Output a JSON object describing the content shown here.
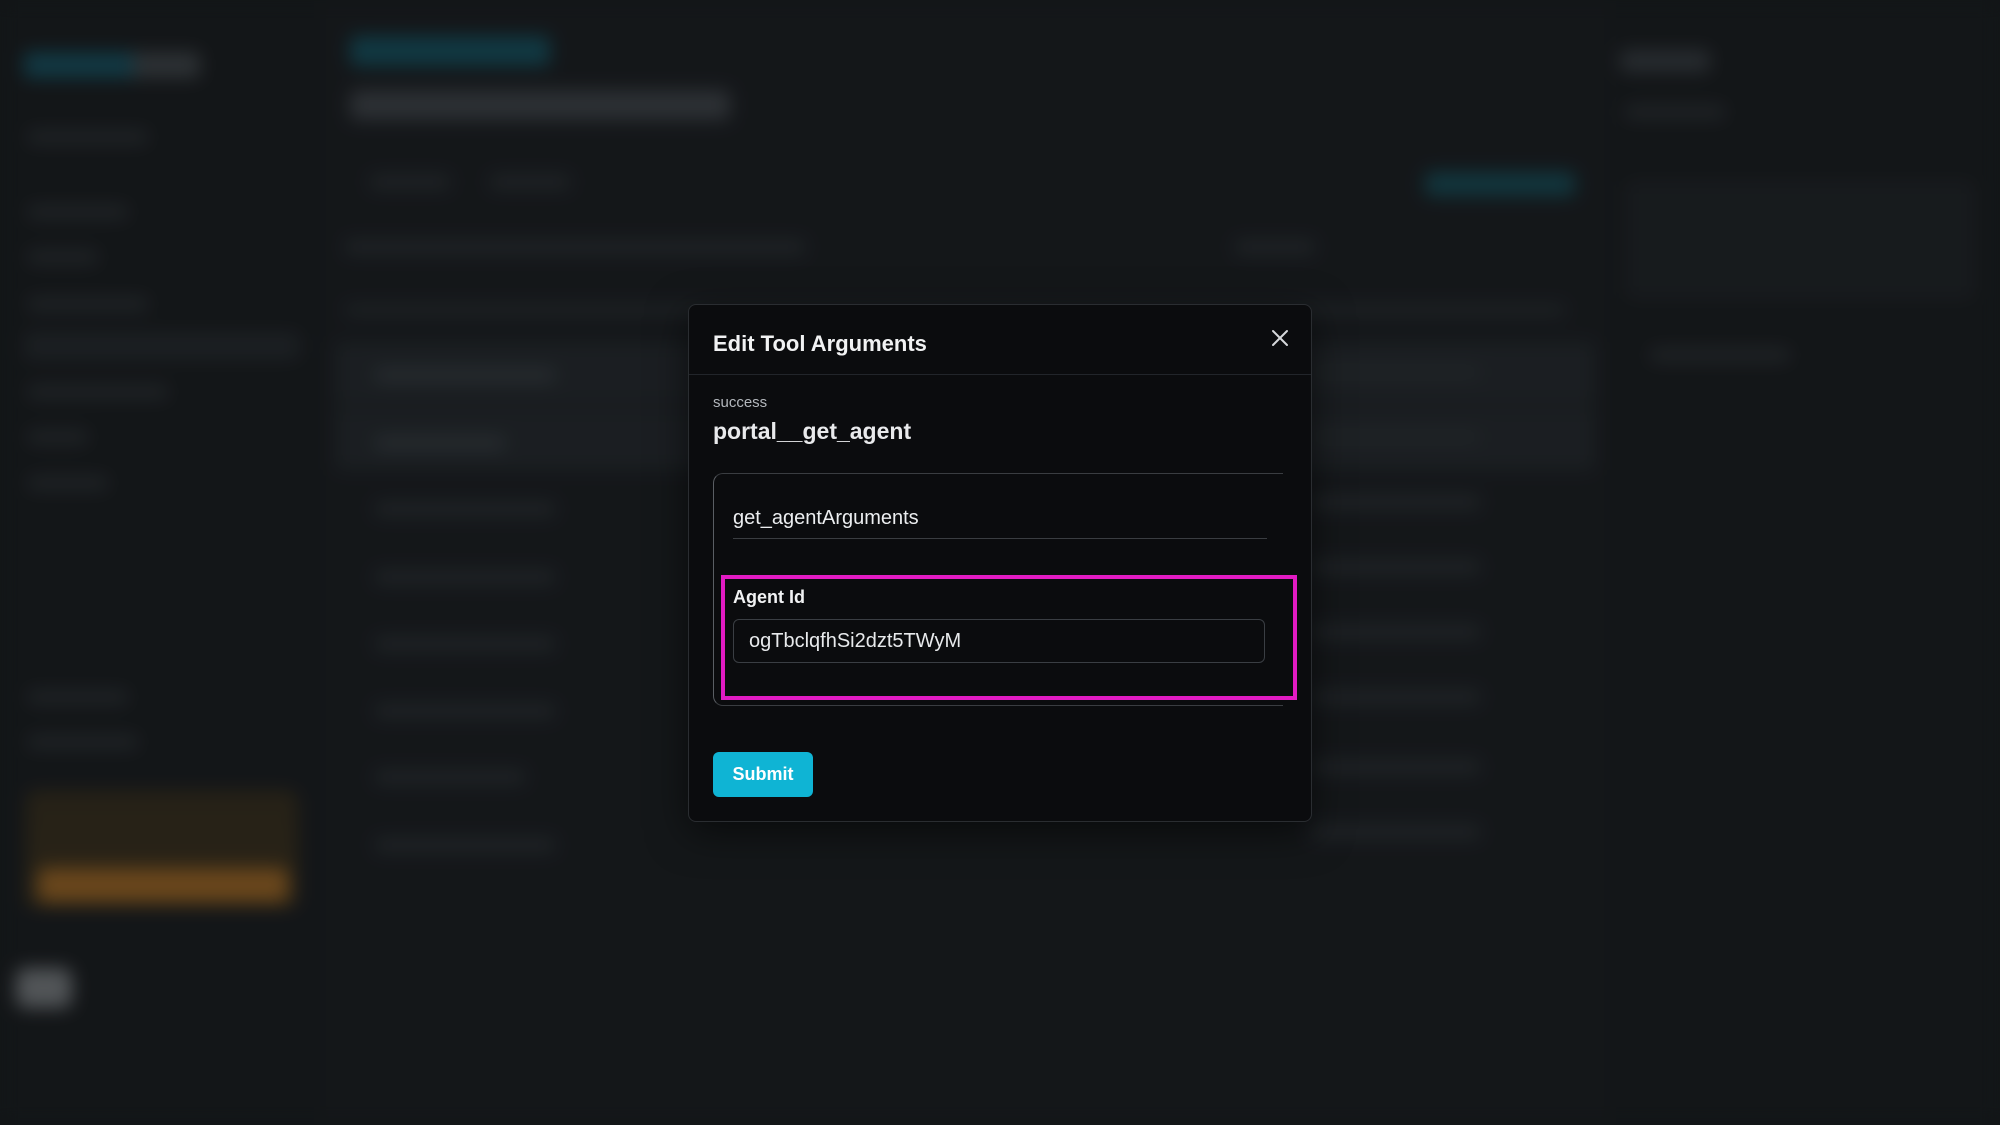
{
  "modal": {
    "title": "Edit Tool Arguments",
    "status": "success",
    "tool_name": "portal__get_agent",
    "arguments_title": "get_agentArguments",
    "field": {
      "label": "Agent Id",
      "value": "ogTbclqfhSi2dzt5TWyM"
    },
    "submit_label": "Submit",
    "close_icon": "close-icon"
  },
  "colors": {
    "accent": "#0fb4d4",
    "highlight": "#e21bc3",
    "modal_bg": "#0b0c0e"
  }
}
